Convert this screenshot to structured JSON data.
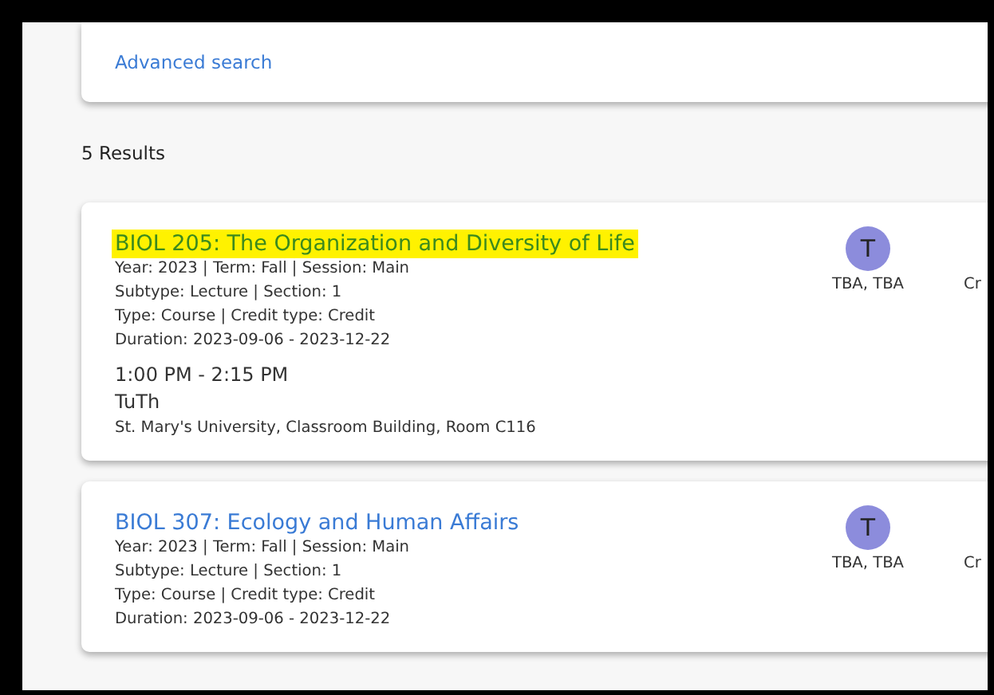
{
  "search_card": {
    "link": "Advanced search"
  },
  "results_count": "5 Results",
  "courses": [
    {
      "title": "BIOL 205: The Organization and Diversity of Life",
      "highlighted": true,
      "details": [
        "Year: 2023 | Term: Fall | Session: Main",
        "Subtype: Lecture | Section: 1",
        "Type: Course | Credit type: Credit",
        "Duration: 2023-09-06 - 2023-12-22"
      ],
      "time": "1:00 PM - 2:15 PM",
      "days": "TuTh",
      "location": "St. Mary's University, Classroom Building, Room C116",
      "instructor_initial": "T",
      "instructors": "TBA, TBA",
      "column_3": "Cr"
    },
    {
      "title": "BIOL 307: Ecology and Human Affairs",
      "highlighted": false,
      "details": [
        "Year: 2023 | Term: Fall | Session: Main",
        "Subtype: Lecture | Section: 1",
        "Type: Course | Credit type: Credit",
        "Duration: 2023-09-06 - 2023-12-22"
      ],
      "instructor_initial": "T",
      "instructors": "TBA, TBA",
      "column_3": "Cr"
    }
  ]
}
